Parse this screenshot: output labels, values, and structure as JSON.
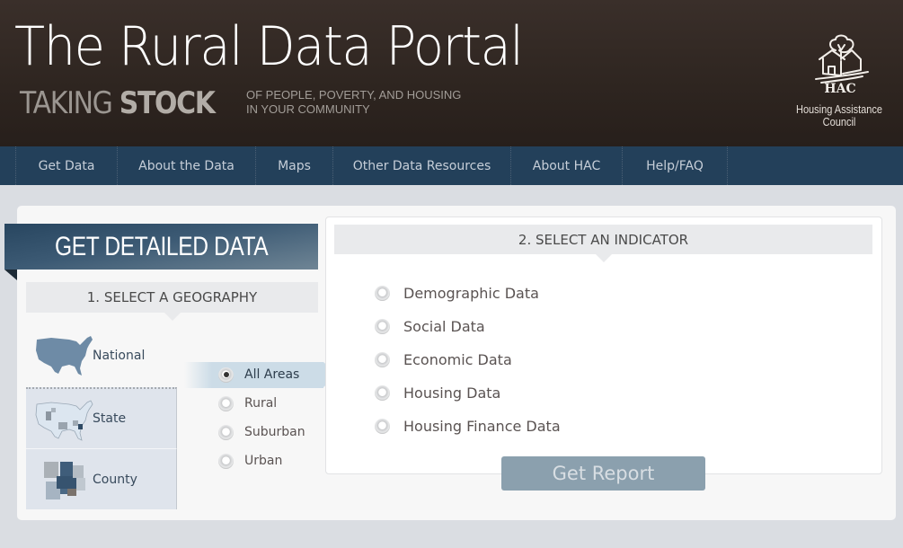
{
  "header": {
    "site_title": "The Rural Data Portal",
    "tagline_light": "TAKING ",
    "tagline_bold": "STOCK",
    "tagline_sub_line1": "OF PEOPLE, POVERTY, AND HOUSING",
    "tagline_sub_line2": "IN YOUR COMMUNITY",
    "org_abbr": "HAC",
    "org_name": "Housing Assistance Council",
    "logo_icon": "house-tree-logo-icon"
  },
  "nav": {
    "items": [
      {
        "label": "Get Data"
      },
      {
        "label": "About the Data"
      },
      {
        "label": "Maps"
      },
      {
        "label": "Other Data Resources"
      },
      {
        "label": "About HAC"
      },
      {
        "label": "Help/FAQ"
      }
    ]
  },
  "main": {
    "title": "GET DETAILED DATA",
    "geography": {
      "header": "1. SELECT A GEOGRAPHY",
      "selected": "National",
      "options": [
        {
          "label": "National",
          "icon": "us-map-icon"
        },
        {
          "label": "State",
          "icon": "states-map-icon"
        },
        {
          "label": "County",
          "icon": "counties-map-icon"
        }
      ]
    },
    "areas": {
      "selected": "All Areas",
      "options": [
        {
          "label": "All Areas",
          "checked": true
        },
        {
          "label": "Rural",
          "checked": false
        },
        {
          "label": "Suburban",
          "checked": false
        },
        {
          "label": "Urban",
          "checked": false
        }
      ]
    },
    "indicator": {
      "header": "2. SELECT AN INDICATOR",
      "options": [
        {
          "label": "Demographic Data",
          "checked": false
        },
        {
          "label": "Social Data",
          "checked": false
        },
        {
          "label": "Economic Data",
          "checked": false
        },
        {
          "label": "Housing Data",
          "checked": false
        },
        {
          "label": "Housing Finance Data",
          "checked": false
        }
      ]
    },
    "report_button": "Get Report"
  },
  "colors": {
    "header_bg": "#2e2520",
    "nav_bg": "#23405a",
    "nav_text": "#c6ced8",
    "ribbon": "#3c5a74",
    "selected_area": "#ccdce7",
    "button_bg": "#8ba0ae",
    "page_bg": "#dadde2"
  }
}
